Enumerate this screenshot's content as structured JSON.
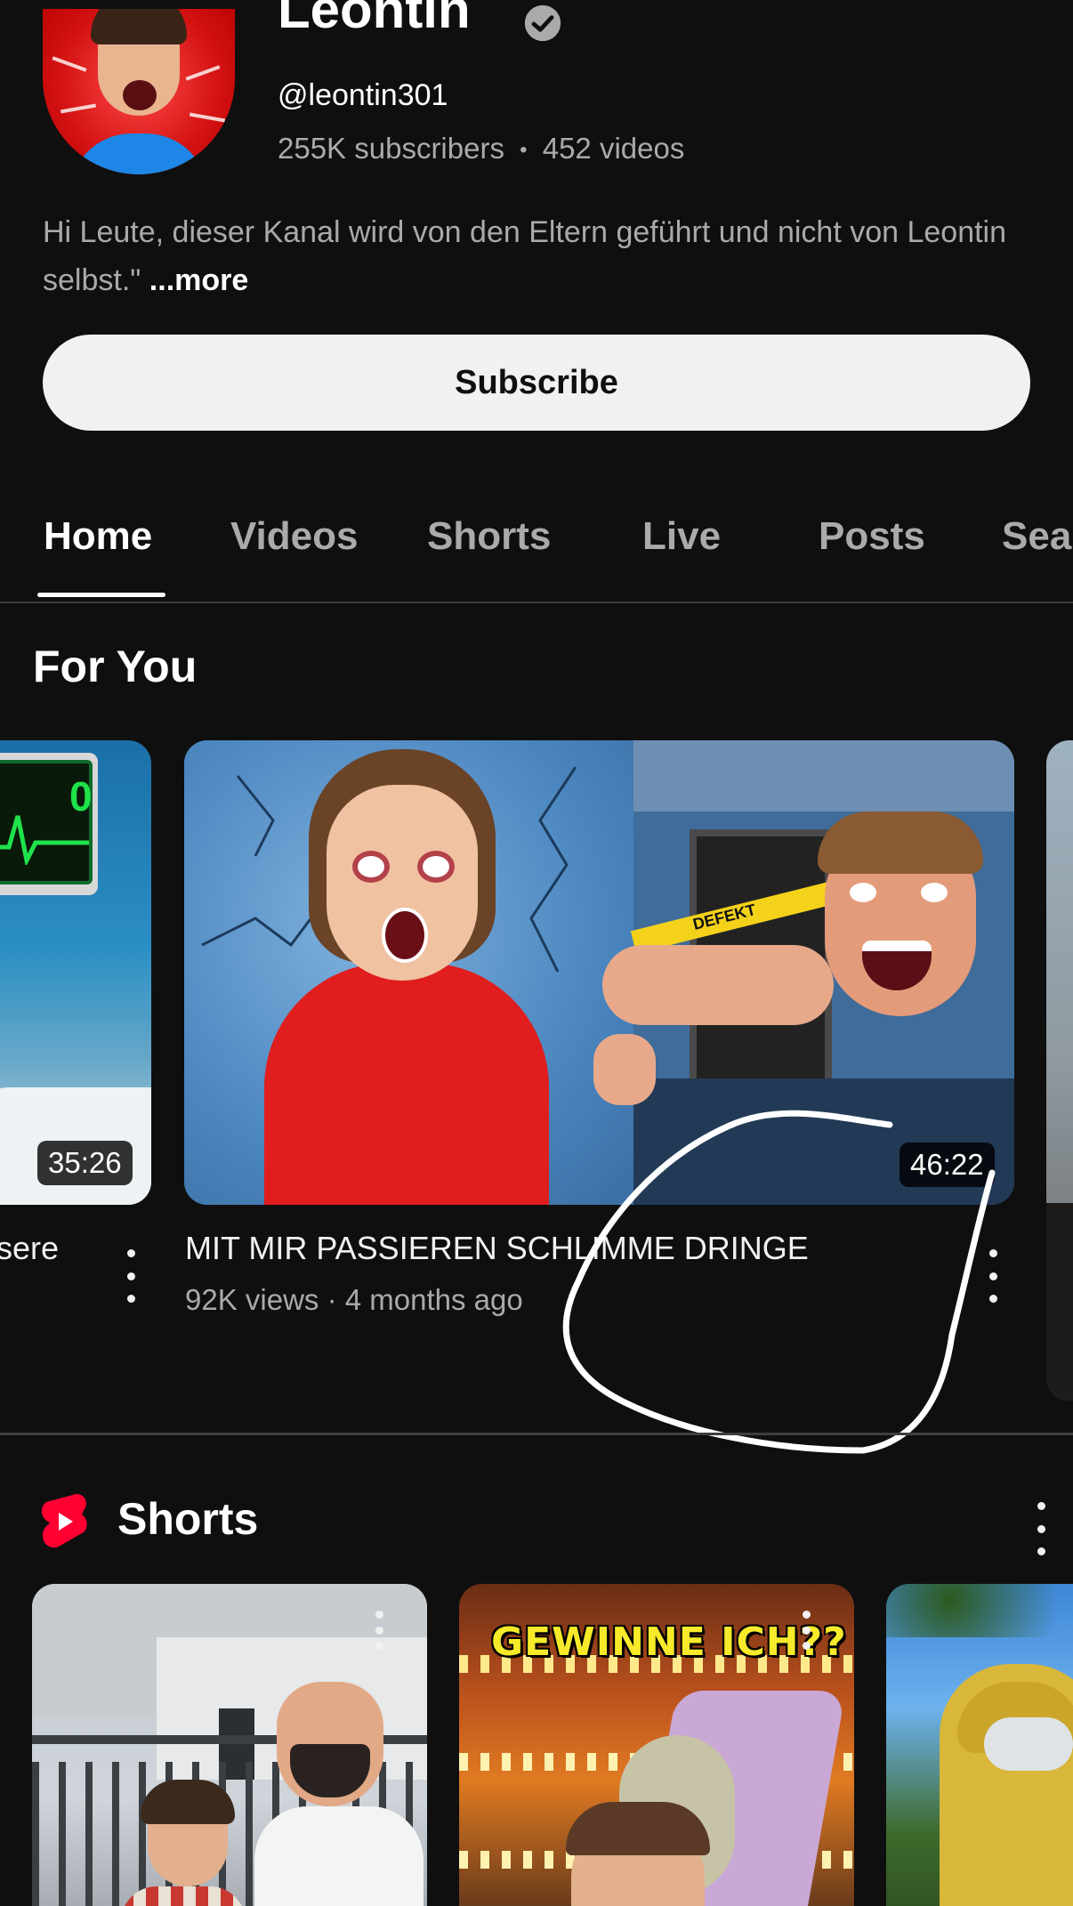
{
  "channel": {
    "name": "Leontin",
    "handle": "@leontin301",
    "subscribers": "255K subscribers",
    "separator": "•",
    "videos": "452 videos",
    "description": "Hi Leute, dieser Kanal wird von den Eltern geführt und nicht von Leontin selbst.\"",
    "more_label": "...more",
    "subscribe_label": "Subscribe"
  },
  "tabs": [
    {
      "label": "Home",
      "active": true
    },
    {
      "label": "Videos",
      "active": false
    },
    {
      "label": "Shorts",
      "active": false
    },
    {
      "label": "Live",
      "active": false
    },
    {
      "label": "Posts",
      "active": false
    },
    {
      "label": "Sea",
      "active": false
    }
  ],
  "for_you": {
    "title": "For You",
    "videos": [
      {
        "title_fragment": "sere",
        "duration": "35:26",
        "monitor_reading": "0"
      },
      {
        "title": "MIT MIR PASSIEREN SCHLIMME DRINGE",
        "views": "92K views",
        "sep": "·",
        "age": "4 months ago",
        "duration": "46:22",
        "sign_text": "DEFEKT"
      }
    ]
  },
  "shorts": {
    "title": "Shorts",
    "cards": [
      {
        "overlay_text": ""
      },
      {
        "overlay_text": "GEWINNE ICH??"
      },
      {
        "overlay_text": ""
      }
    ]
  },
  "colors": {
    "background": "#0f0f0f",
    "text_primary": "#f1f1f1",
    "text_secondary": "#aaaaaa",
    "shorts_red": "#ff0033"
  }
}
